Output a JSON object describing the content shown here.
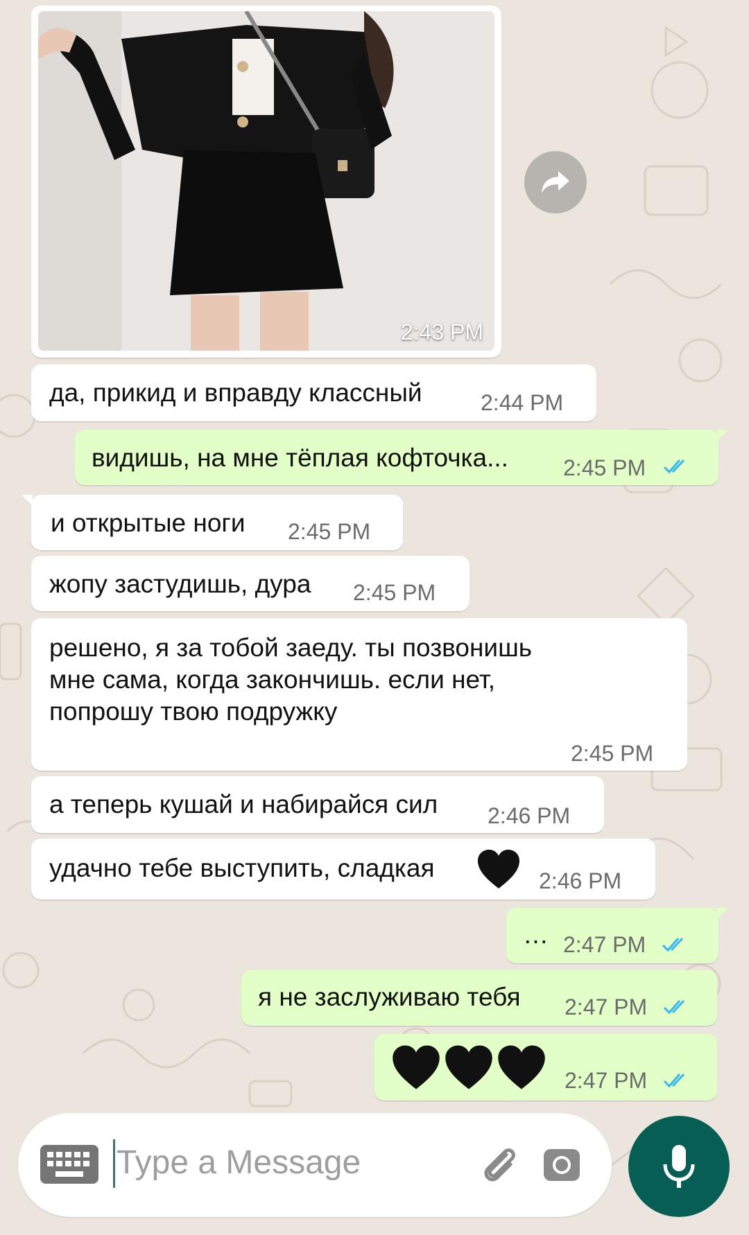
{
  "composer": {
    "placeholder": "Type a Message",
    "icons": [
      "keyboard-icon",
      "paperclip-icon",
      "camera-icon",
      "microphone-icon"
    ]
  },
  "photo_message": {
    "time": "2:43 PM",
    "description_icon": "image"
  },
  "forward_button": {
    "icon": "forward-arrow-icon"
  },
  "messages": [
    {
      "dir": "in",
      "text": "да, прикид и вправду классный",
      "time": "2:44 PM"
    },
    {
      "dir": "out",
      "text": "видишь, на мне тёплая кофточка...",
      "time": "2:45 PM",
      "status": "read"
    },
    {
      "dir": "in",
      "text": "и открытые ноги",
      "time": "2:45 PM"
    },
    {
      "dir": "in",
      "text": "жопу застудишь, дура",
      "time": "2:45 PM"
    },
    {
      "dir": "in",
      "text": "решено, я за тобой заеду. ты позвонишь мне сама, когда закончишь. если нет, попрошу твою подружку",
      "time": "2:45 PM"
    },
    {
      "dir": "in",
      "text": "а теперь кушай и набирайся сил",
      "time": "2:46 PM"
    },
    {
      "dir": "in",
      "text": "удачно тебе выступить, сладкая",
      "emoji": "black-heart",
      "time": "2:46 PM"
    },
    {
      "dir": "out",
      "text": "…",
      "time": "2:47 PM",
      "status": "read"
    },
    {
      "dir": "out",
      "text": "я не заслуживаю тебя",
      "time": "2:47 PM",
      "status": "read"
    },
    {
      "dir": "out",
      "text": "",
      "emoji": "black-heart x3",
      "time": "2:47 PM",
      "status": "read"
    }
  ],
  "colors": {
    "background": "#ECE5DD",
    "incoming": "#FFFFFF",
    "outgoing": "#E2FFC7",
    "read_ticks": "#34B7F1",
    "mic_button": "#075E54"
  }
}
